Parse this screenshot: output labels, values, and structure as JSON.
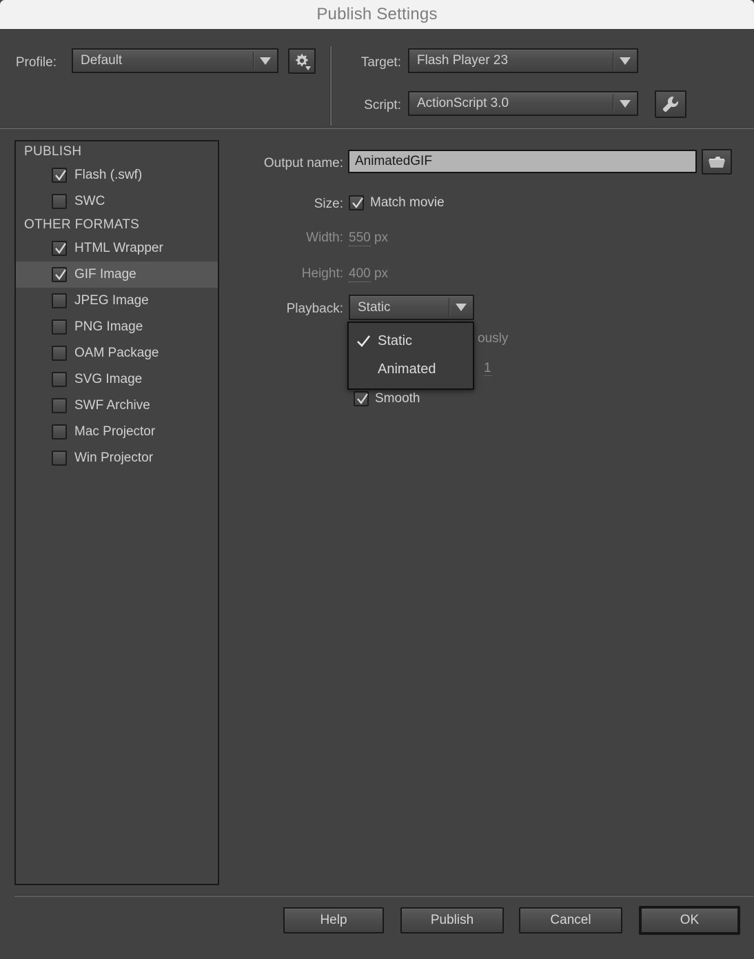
{
  "window": {
    "title": "Publish Settings"
  },
  "header": {
    "profile_label": "Profile:",
    "profile_value": "Default",
    "profile_settings_icon": "gear-icon",
    "target_label": "Target:",
    "target_value": "Flash Player 23",
    "script_label": "Script:",
    "script_value": "ActionScript 3.0",
    "script_settings_icon": "wrench-icon"
  },
  "format_list": {
    "groups": [
      {
        "title": "PUBLISH",
        "items": [
          {
            "label": "Flash (.swf)",
            "checked": true,
            "selected": false
          },
          {
            "label": "SWC",
            "checked": false,
            "selected": false
          }
        ]
      },
      {
        "title": "OTHER FORMATS",
        "items": [
          {
            "label": "HTML Wrapper",
            "checked": true,
            "selected": false
          },
          {
            "label": "GIF Image",
            "checked": true,
            "selected": true
          },
          {
            "label": "JPEG Image",
            "checked": false,
            "selected": false
          },
          {
            "label": "PNG Image",
            "checked": false,
            "selected": false
          },
          {
            "label": "OAM Package",
            "checked": false,
            "selected": false
          },
          {
            "label": "SVG Image",
            "checked": false,
            "selected": false
          },
          {
            "label": "SWF Archive",
            "checked": false,
            "selected": false
          },
          {
            "label": "Mac Projector",
            "checked": false,
            "selected": false
          },
          {
            "label": "Win Projector",
            "checked": false,
            "selected": false
          }
        ]
      }
    ]
  },
  "gif_settings": {
    "output_name_label": "Output name:",
    "output_name_value": "AnimatedGIF",
    "browse_icon": "folder-icon",
    "size_label": "Size:",
    "match_movie_label": "Match movie",
    "match_movie_checked": true,
    "width_label": "Width:",
    "width_value": "550",
    "width_unit": "px",
    "height_label": "Height:",
    "height_value": "400",
    "height_unit": "px",
    "playback_label": "Playback:",
    "playback_value": "Static",
    "playback_options": [
      "Static",
      "Animated"
    ],
    "playback_menu_open": true,
    "playback_selected_option": "Static",
    "loop_text_occluded": "ously",
    "repeat_count_occluded": "1",
    "smooth_label": "Smooth",
    "smooth_checked": true
  },
  "footer": {
    "help_label": "Help",
    "publish_label": "Publish",
    "cancel_label": "Cancel",
    "ok_label": "OK"
  },
  "colors": {
    "dialog_bg": "#424242",
    "titlebar_bg": "#f2f2f2",
    "title_text": "#7d7d7d",
    "text_primary": "#d2d2d2",
    "text_dim": "#8e8e8e",
    "selection_bg": "#565656",
    "input_bg": "#b4b4b4"
  }
}
